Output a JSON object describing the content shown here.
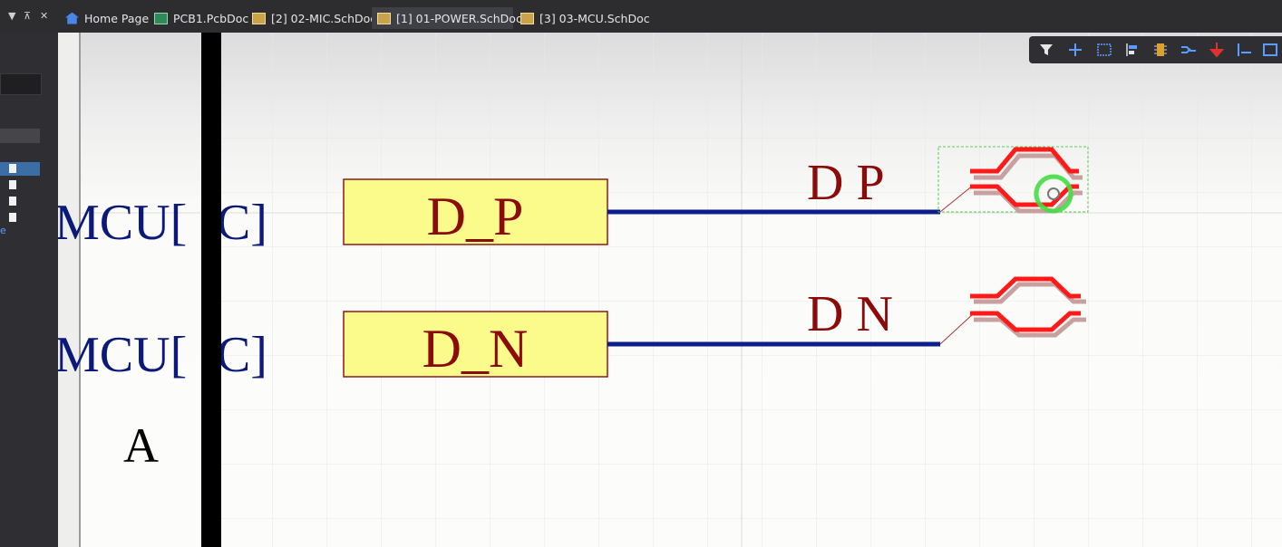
{
  "tabs": [
    {
      "label": "Home Page",
      "icon": "home-icon",
      "active": false
    },
    {
      "label": "PCB1.PcbDoc",
      "icon": "pcb-doc-icon",
      "active": false
    },
    {
      "label": "[2] 02-MIC.SchDoc",
      "icon": "schematic-doc-icon",
      "active": false
    },
    {
      "label": "[1] 01-POWER.SchDoc",
      "icon": "schematic-doc-icon",
      "active": true
    },
    {
      "label": "[3] 03-MCU.SchDoc",
      "icon": "schematic-doc-icon",
      "active": false
    }
  ],
  "panel_controls": {
    "menu": "▼",
    "pin": "⊼",
    "close": "✕"
  },
  "left_panel": {
    "truncated_label": "e"
  },
  "schematic": {
    "border_zone_letter": "A",
    "ports": [
      {
        "offsheet_label": "MCU[ ]C]",
        "port_name": "D_P",
        "net_label": "D P"
      },
      {
        "offsheet_label": "MCU[ ]C]",
        "port_name": "D_N",
        "net_label": "D N"
      }
    ],
    "colors": {
      "port_fill": "#fbfb8c",
      "port_text": "#8b0a0a",
      "wire": "#0b1f8c",
      "offsheet_text": "#0b1a78",
      "diffpair": "#ff1a1a",
      "selection": "#44dd44"
    }
  },
  "toolbar": {
    "icons": [
      "filter-icon",
      "cross-hair-icon",
      "select-rect-icon",
      "align-icon",
      "component-icon",
      "wire-icon",
      "power-port-icon",
      "bus-icon",
      "more-icon"
    ]
  }
}
